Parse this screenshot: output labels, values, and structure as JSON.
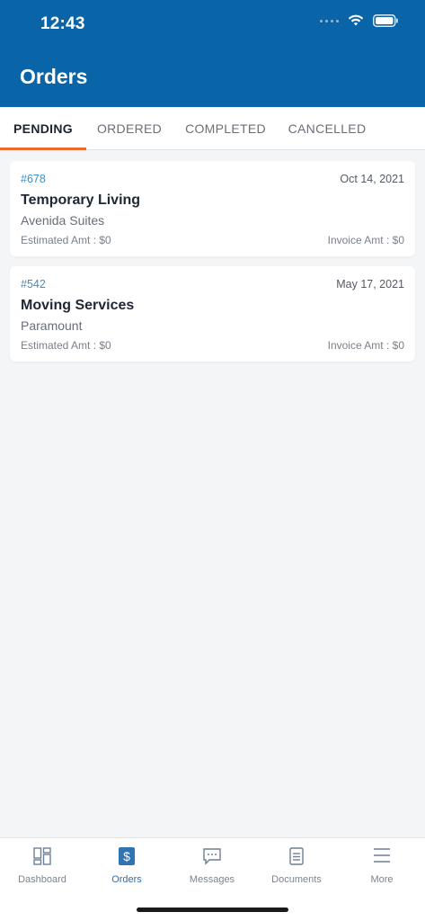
{
  "status_bar": {
    "time": "12:43"
  },
  "header": {
    "title": "Orders"
  },
  "tabs": [
    {
      "label": "PENDING",
      "active": true
    },
    {
      "label": "ORDERED",
      "active": false
    },
    {
      "label": "COMPLETED",
      "active": false
    },
    {
      "label": "CANCELLED",
      "active": false
    }
  ],
  "orders": [
    {
      "id": "#678",
      "date": "Oct 14, 2021",
      "title": "Temporary Living",
      "vendor": "Avenida Suites",
      "estimated": "Estimated Amt : $0",
      "invoice": "Invoice Amt : $0"
    },
    {
      "id": "#542",
      "date": "May 17, 2021",
      "title": "Moving Services",
      "vendor": "Paramount",
      "estimated": "Estimated Amt : $0",
      "invoice": "Invoice Amt : $0"
    }
  ],
  "bottom_nav": [
    {
      "label": "Dashboard",
      "icon": "dashboard-icon"
    },
    {
      "label": "Orders",
      "icon": "dollar-icon",
      "active": true
    },
    {
      "label": "Messages",
      "icon": "chat-icon"
    },
    {
      "label": "Documents",
      "icon": "document-icon"
    },
    {
      "label": "More",
      "icon": "menu-icon"
    }
  ],
  "colors": {
    "header": "#0a64a8",
    "tab_accent": "#ef6a2e",
    "order_id": "#3a8fd1",
    "nav_active": "#2a6fb0"
  }
}
